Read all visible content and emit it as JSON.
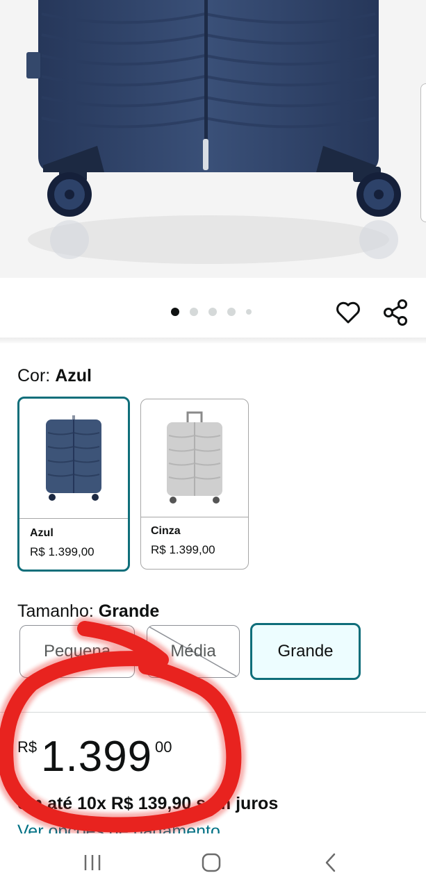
{
  "product_image": {
    "icon": "suitcase-photo",
    "color": "#2f4366"
  },
  "carousel": {
    "total_dots": 5,
    "active_index": 0
  },
  "actions": {
    "wishlist_icon": "heart-outline-icon",
    "share_icon": "share-icon"
  },
  "color_selector": {
    "label": "Cor: ",
    "selected_value": "Azul",
    "options": [
      {
        "name": "Azul",
        "price": "R$ 1.399,00",
        "selected": true,
        "swatch_color": "#3d5478"
      },
      {
        "name": "Cinza",
        "price": "R$ 1.399,00",
        "selected": false,
        "swatch_color": "#cfcfcf"
      }
    ]
  },
  "size_selector": {
    "label": "Tamanho: ",
    "selected_value": "Grande",
    "options": [
      {
        "label": "Pequena",
        "available": false
      },
      {
        "label": "Média",
        "available": false
      },
      {
        "label": "Grande",
        "available": true,
        "selected": true
      }
    ]
  },
  "price": {
    "currency": "R$",
    "whole": "1.399",
    "fraction": "00",
    "installments": "em até 10x R$ 139,90 sem juros",
    "payment_options_link": "Ver opções de pagamento"
  },
  "annotation": {
    "color": "#e8231f"
  },
  "nav": {
    "recent_icon": "recent-apps-icon",
    "home_icon": "home-icon",
    "back_icon": "back-icon"
  },
  "colors": {
    "accent": "#0f6e7a",
    "link": "#007185",
    "selected_bg": "#edfdff"
  }
}
